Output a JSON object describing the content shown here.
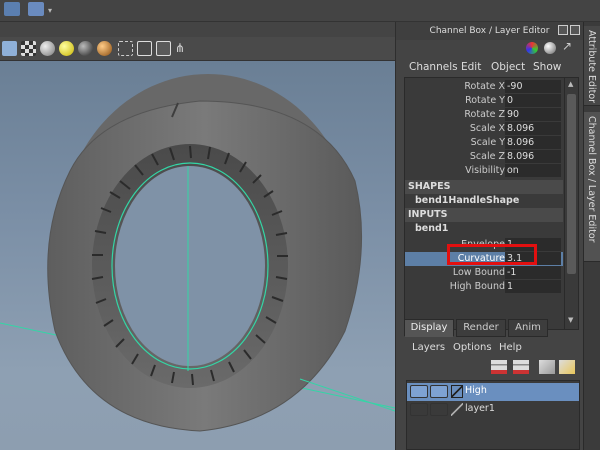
{
  "panel": {
    "title": "Channel Box / Layer Editor",
    "menu": [
      "Channels",
      "Edit",
      "Object",
      "Show"
    ]
  },
  "channels": [
    {
      "label": "Rotate X",
      "value": "-90"
    },
    {
      "label": "Rotate Y",
      "value": "0"
    },
    {
      "label": "Rotate Z",
      "value": "90"
    },
    {
      "label": "Scale X",
      "value": "8.096"
    },
    {
      "label": "Scale Y",
      "value": "8.096"
    },
    {
      "label": "Scale Z",
      "value": "8.096"
    },
    {
      "label": "Visibility",
      "value": "on"
    }
  ],
  "shapes": {
    "header": "SHAPES",
    "item": "bend1HandleShape"
  },
  "inputs": {
    "header": "INPUTS",
    "item": "bend1",
    "attrs": [
      {
        "label": "Envelope",
        "value": "1"
      },
      {
        "label": "Curvature",
        "value": "3.1"
      },
      {
        "label": "Low Bound",
        "value": "-1"
      },
      {
        "label": "High Bound",
        "value": "1"
      }
    ]
  },
  "tabs": [
    "Display",
    "Render",
    "Anim"
  ],
  "layer_menu": [
    "Layers",
    "Options",
    "Help"
  ],
  "layers": [
    {
      "name": "High",
      "selected": true
    },
    {
      "name": "layer1",
      "selected": false
    }
  ],
  "side_tabs": [
    "Attribute Editor",
    "Channel Box / Layer Editor"
  ],
  "colors": {
    "accent": "#5d7fa6",
    "highlight_box": "#e21010",
    "manipulator": "#33d6a6"
  }
}
